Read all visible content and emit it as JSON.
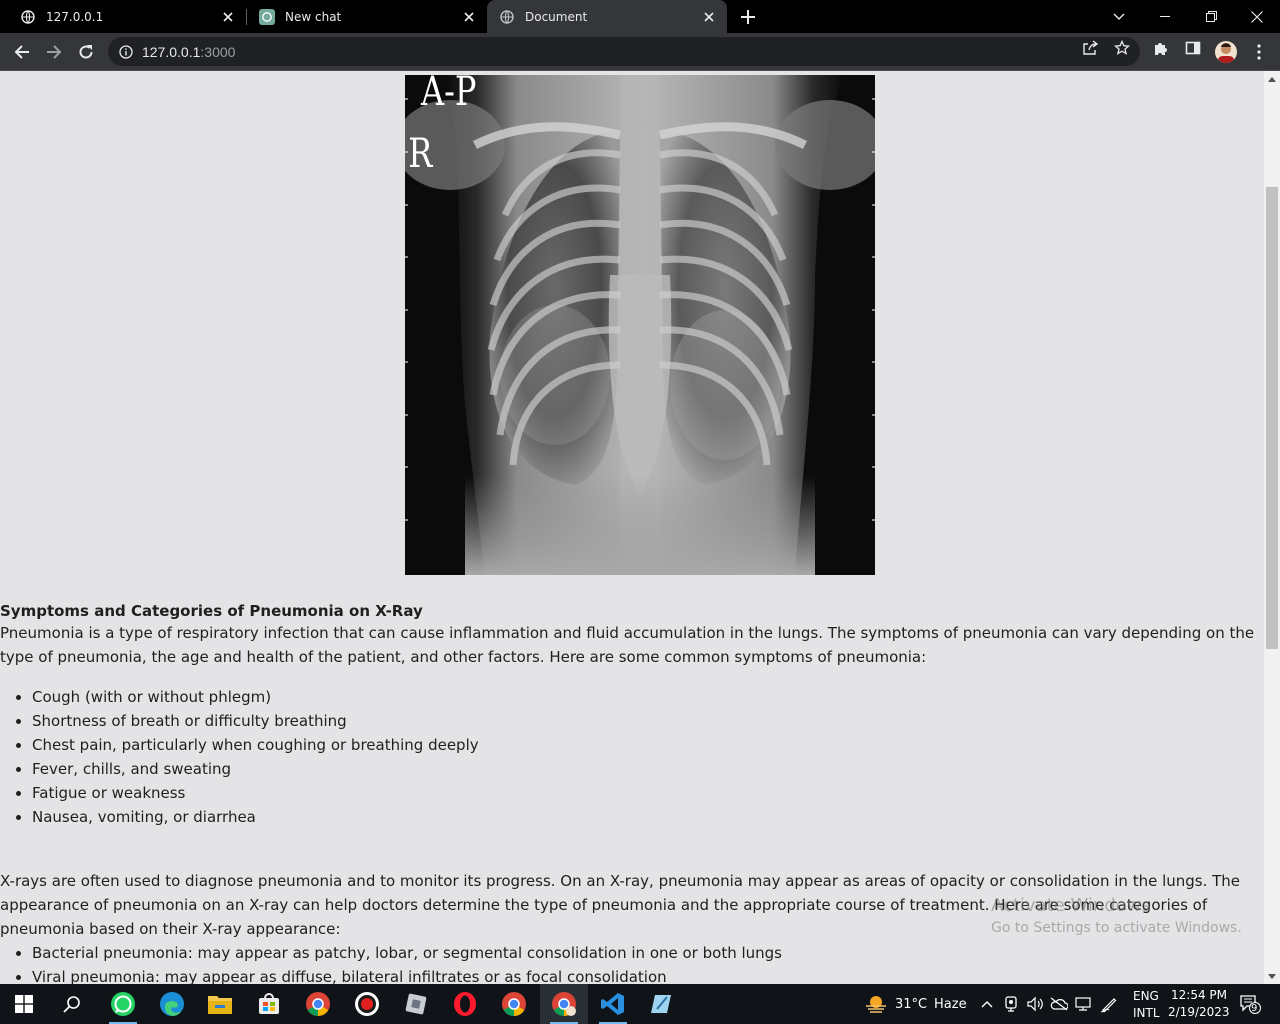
{
  "browser": {
    "tabs": [
      {
        "title": "127.0.0.1",
        "active": false
      },
      {
        "title": "New chat",
        "active": false
      },
      {
        "title": "Document",
        "active": true
      }
    ],
    "url_host": "127.0.0.1",
    "url_port": ":3000"
  },
  "xray": {
    "label_view": "A-P",
    "label_side": "R"
  },
  "article": {
    "heading": "Symptoms and Categories of Pneumonia on X-Ray",
    "intro": "Pneumonia is a type of respiratory infection that can cause inflammation and fluid accumulation in the lungs. The symptoms of pneumonia can vary depending on the type of pneumonia, the age and health of the patient, and other factors. Here are some common symptoms of pneumonia:",
    "symptoms": [
      "Cough (with or without phlegm)",
      "Shortness of breath or difficulty breathing",
      "Chest pain, particularly when coughing or breathing deeply",
      "Fever, chills, and sweating",
      "Fatigue or weakness",
      "Nausea, vomiting, or diarrhea"
    ],
    "xray_paragraph": "X-rays are often used to diagnose pneumonia and to monitor its progress. On an X-ray, pneumonia may appear as areas of opacity or consolidation in the lungs. The appearance of pneumonia on an X-ray can help doctors determine the type of pneumonia and the appropriate course of treatment. Here are some categories of pneumonia based on their X-ray appearance:",
    "categories": [
      "Bacterial pneumonia: may appear as patchy, lobar, or segmental consolidation in one or both lungs",
      "Viral pneumonia: may appear as diffuse, bilateral infiltrates or as focal consolidation"
    ]
  },
  "watermark": {
    "line1": "Activate Windows",
    "line2": "Go to Settings to activate Windows."
  },
  "taskbar": {
    "weather_temp": "31°C",
    "weather_desc": "Haze",
    "lang_line1": "ENG",
    "lang_line2": "INTL",
    "time": "12:54 PM",
    "date": "2/19/2023",
    "notification_count": "9"
  }
}
